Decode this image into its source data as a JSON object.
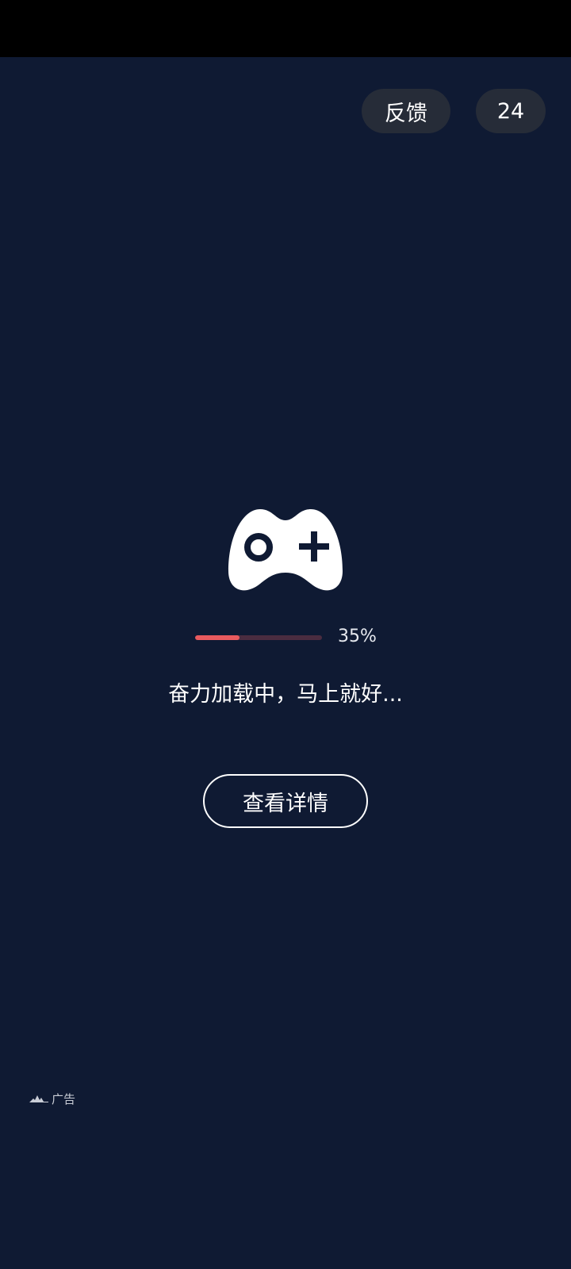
{
  "top_actions": {
    "feedback_label": "反馈",
    "countdown": "24"
  },
  "loading": {
    "icon": "gamepad-icon",
    "progress_percent": 35,
    "progress_label": "35%",
    "message": "奋力加载中，马上就好..."
  },
  "details_button": {
    "label": "查看详情"
  },
  "ad": {
    "logo_icon": "ad-network-logo-icon",
    "label": "广告"
  },
  "colors": {
    "background": "#0f1a33",
    "progress_fill": "#e85a5e",
    "progress_track": "#4a2c40",
    "pill_background": "#262c38"
  }
}
